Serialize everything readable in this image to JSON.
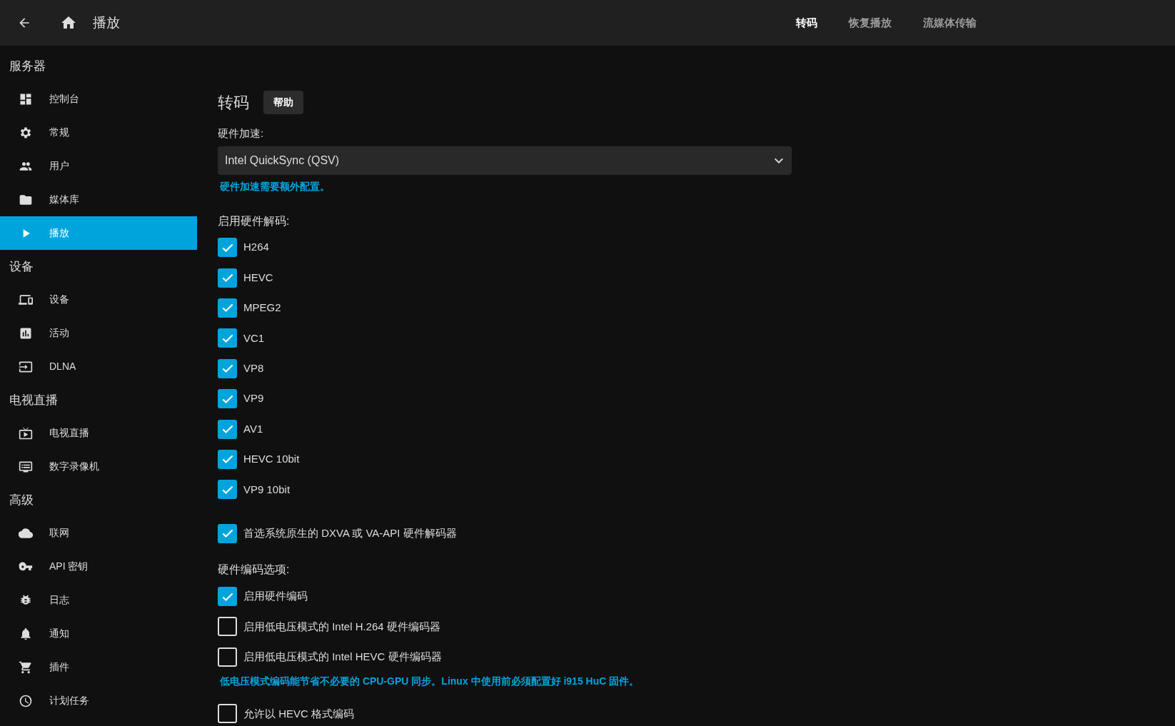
{
  "header": {
    "title": "播放",
    "tabs": [
      {
        "label": "转码",
        "selected": true
      },
      {
        "label": "恢复播放",
        "selected": false
      },
      {
        "label": "流媒体传输",
        "selected": false
      }
    ]
  },
  "sidebar": {
    "sections": [
      {
        "heading": "服务器",
        "items": [
          {
            "label": "控制台",
            "selected": false
          },
          {
            "label": "常规",
            "selected": false
          },
          {
            "label": "用户",
            "selected": false
          },
          {
            "label": "媒体库",
            "selected": false
          },
          {
            "label": "播放",
            "selected": true
          }
        ]
      },
      {
        "heading": "设备",
        "items": [
          {
            "label": "设备",
            "selected": false
          },
          {
            "label": "活动",
            "selected": false
          },
          {
            "label": "DLNA",
            "selected": false
          }
        ]
      },
      {
        "heading": "电视直播",
        "items": [
          {
            "label": "电视直播",
            "selected": false
          },
          {
            "label": "数字录像机",
            "selected": false
          }
        ]
      },
      {
        "heading": "高级",
        "items": [
          {
            "label": "联网",
            "selected": false
          },
          {
            "label": "API 密钥",
            "selected": false
          },
          {
            "label": "日志",
            "selected": false
          },
          {
            "label": "通知",
            "selected": false
          },
          {
            "label": "插件",
            "selected": false
          },
          {
            "label": "计划任务",
            "selected": false
          }
        ]
      }
    ]
  },
  "content": {
    "title": "转码",
    "help_button": "帮助",
    "hw_accel": {
      "label": "硬件加速:",
      "value": "Intel QuickSync (QSV)",
      "note": "硬件加速需要额外配置。"
    },
    "decode": {
      "label": "启用硬件解码:",
      "options": [
        {
          "label": "H264",
          "checked": true
        },
        {
          "label": "HEVC",
          "checked": true
        },
        {
          "label": "MPEG2",
          "checked": true
        },
        {
          "label": "VC1",
          "checked": true
        },
        {
          "label": "VP8",
          "checked": true
        },
        {
          "label": "VP9",
          "checked": true
        },
        {
          "label": "AV1",
          "checked": true
        },
        {
          "label": "HEVC 10bit",
          "checked": true
        },
        {
          "label": "VP9 10bit",
          "checked": true
        }
      ]
    },
    "prefer_native": {
      "label": "首选系统原生的 DXVA 或 VA-API 硬件解码器",
      "checked": true
    },
    "encode": {
      "label": "硬件编码选项:",
      "options": [
        {
          "label": "启用硬件编码",
          "checked": true
        },
        {
          "label": "启用低电压模式的 Intel H.264 硬件编码器",
          "checked": false
        },
        {
          "label": "启用低电压模式的 Intel HEVC 硬件编码器",
          "checked": false
        }
      ],
      "note": "低电压模式编码能节省不必要的 CPU-GPU 同步。Linux 中使用前必须配置好 i915 HuC 固件。"
    },
    "hevc_encoding": {
      "label": "允许以 HEVC 格式编码",
      "checked": false
    }
  }
}
